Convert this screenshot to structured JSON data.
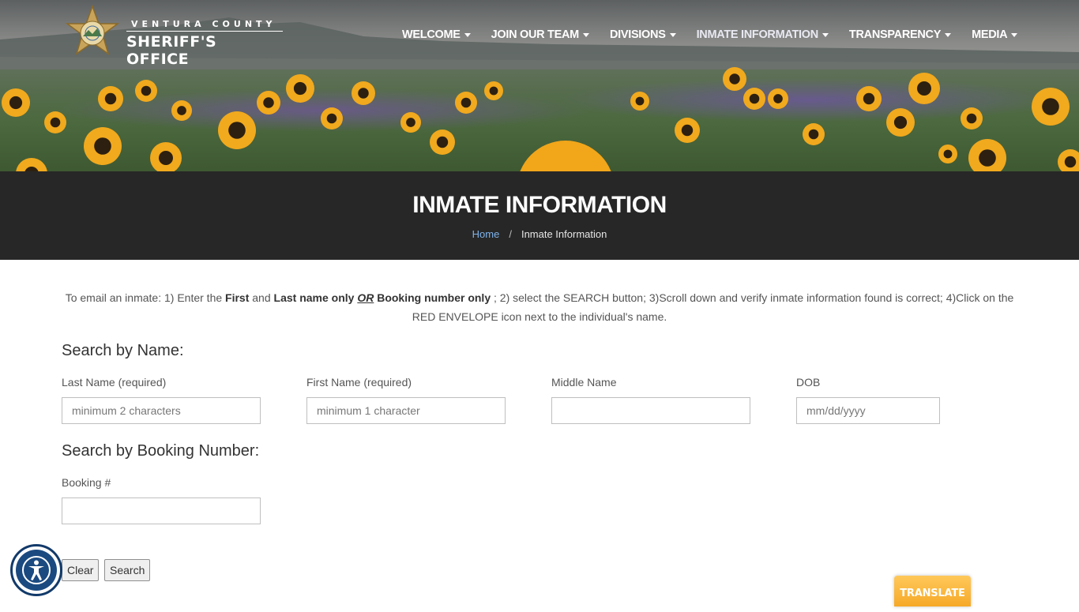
{
  "header": {
    "brand_top": "VENTURA COUNTY",
    "brand_main": "SHERIFF'S OFFICE",
    "nav": [
      {
        "label": "WELCOME"
      },
      {
        "label": "JOIN OUR TEAM"
      },
      {
        "label": "DIVISIONS"
      },
      {
        "label": "INMATE INFORMATION"
      },
      {
        "label": "TRANSPARENCY"
      },
      {
        "label": "MEDIA"
      }
    ]
  },
  "band": {
    "title": "INMATE INFORMATION",
    "breadcrumb_home": "Home",
    "breadcrumb_sep": "/",
    "breadcrumb_current": "Inmate Information"
  },
  "instructions": {
    "p1": "To email an inmate: 1) Enter the ",
    "first": "First",
    "and": " and ",
    "last_only": "Last name only",
    "or": "OR",
    "booking_only": "Booking number only",
    "p2": " ; 2) select the SEARCH button;  3)Scroll down and verify inmate information found is correct; 4)Click on the RED ENVELOPE icon next to the individual's name."
  },
  "name_search": {
    "title": "Search by Name:",
    "last_label": "Last Name (required)",
    "last_placeholder": "minimum 2 characters",
    "first_label": "First Name (required)",
    "first_placeholder": "minimum 1 character",
    "middle_label": "Middle Name",
    "dob_label": "DOB",
    "dob_placeholder": "mm/dd/yyyy"
  },
  "booking_search": {
    "title": "Search by Booking Number:",
    "label": "Booking #"
  },
  "buttons": {
    "clear": "Clear",
    "search": "Search"
  },
  "widgets": {
    "translate": "TRANSLATE"
  },
  "colors": {
    "band": "#272727",
    "link": "#7fb3ea",
    "translate": "#f6a928",
    "accessibility": "#1b4a80"
  }
}
